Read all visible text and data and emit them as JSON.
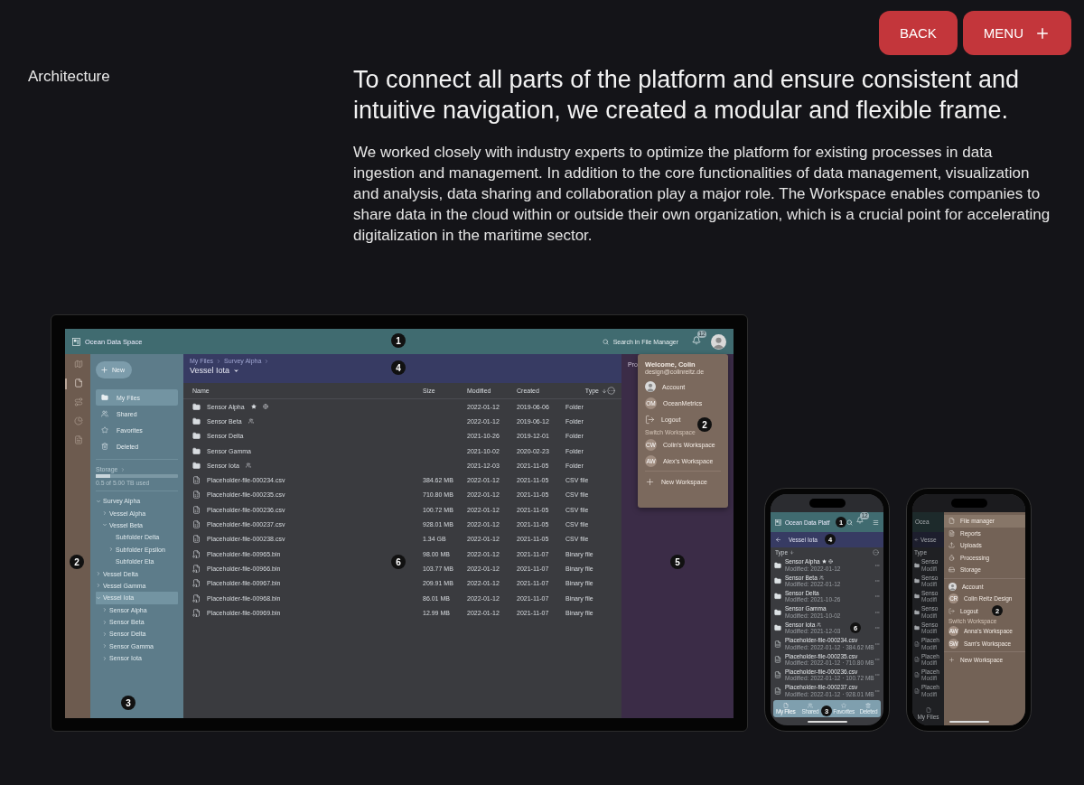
{
  "nav_buttons": [
    {
      "label": "BACK",
      "kind": "text"
    },
    {
      "label": "MENU",
      "kind": "plus"
    }
  ],
  "section_label": "Architecture",
  "heading": "To connect all parts of the platform and ensure consistent and intuitive navigation, we created a modular and flexible frame.",
  "body": "We worked closely with industry experts to optimize the platform for existing processes in data ingestion and management. In addition to the core functionalities of data management, visualization and analysis, data sharing and collaboration play a major role. The Workspace enables companies to share data in the cloud within or outside their own organization, which is a crucial point for accelerating digitalization in the maritime sector.",
  "desktop": {
    "app_title": "Ocean Data Space",
    "search_label": "Search in File Manager",
    "notification_count": "12",
    "rail": [
      {
        "kind": "map",
        "selected": false
      },
      {
        "kind": "file",
        "selected": true
      },
      {
        "kind": "route",
        "selected": false
      },
      {
        "kind": "chart",
        "selected": false
      },
      {
        "kind": "report",
        "selected": false
      }
    ],
    "new_button": "New",
    "nav_items": [
      {
        "label": "My Files",
        "kind": "folder",
        "selected": true
      },
      {
        "label": "Shared",
        "kind": "people",
        "selected": false
      },
      {
        "label": "Favorites",
        "kind": "star",
        "selected": false
      },
      {
        "label": "Deleted",
        "kind": "trash",
        "selected": false
      }
    ],
    "storage": {
      "label": "Storage",
      "level": 0.18,
      "caption": "0.5 of 5.00 TB used"
    },
    "tree": [
      {
        "label": "Survey Alpha",
        "expanded": true,
        "selected": false,
        "children": [
          {
            "label": "Vessel Alpha",
            "expanded": false,
            "selected": false
          },
          {
            "label": "Vessel Beta",
            "expanded": true,
            "selected": false,
            "children": [
              {
                "label": "Subfolder Delta",
                "selected": false
              },
              {
                "label": "Subfolder Epsilon",
                "expanded": false,
                "selected": false
              },
              {
                "label": "Subfolder Eta",
                "selected": false
              }
            ]
          }
        ]
      },
      {
        "label": "Vessel Delta",
        "expanded": false,
        "selected": false
      },
      {
        "label": "Vessel Gamma",
        "expanded": false,
        "selected": false
      },
      {
        "label": "Vessel Iota",
        "expanded": true,
        "selected": true,
        "children": [
          {
            "label": "Sensor Alpha",
            "expanded": false,
            "selected": false
          },
          {
            "label": "Sensor Beta",
            "expanded": false,
            "selected": false
          },
          {
            "label": "Sensor Delta",
            "expanded": false,
            "selected": false
          },
          {
            "label": "Sensor Gamma",
            "expanded": false,
            "selected": false
          },
          {
            "label": "Sensor Iota",
            "expanded": false,
            "selected": false
          }
        ]
      }
    ],
    "breadcrumb": [
      "My Files",
      "Survey Alpha"
    ],
    "folder_title": "Vessel Iota",
    "columns": [
      {
        "label": "Name",
        "sorted": false
      },
      {
        "label": "Size",
        "sorted": false
      },
      {
        "label": "Modified",
        "sorted": false
      },
      {
        "label": "Created",
        "sorted": false
      },
      {
        "label": "Type",
        "sorted": true
      }
    ],
    "rows": [
      {
        "kind": "folder",
        "name": "Sensor Alpha",
        "modified": "2022-01-12",
        "created": "2019-06-06",
        "type": "Folder",
        "starred": true,
        "public": true,
        "shared": false
      },
      {
        "kind": "folder",
        "name": "Sensor Beta",
        "modified": "2022-01-12",
        "created": "2019-06-12",
        "type": "Folder",
        "starred": false,
        "public": false,
        "shared": true
      },
      {
        "kind": "folder",
        "name": "Sensor Delta",
        "modified": "2021-10-26",
        "created": "2019-12-01",
        "type": "Folder",
        "starred": false,
        "public": false,
        "shared": false
      },
      {
        "kind": "folder",
        "name": "Sensor Gamma",
        "modified": "2021-10-02",
        "created": "2020-02-23",
        "type": "Folder",
        "starred": false,
        "public": false,
        "shared": false
      },
      {
        "kind": "folder",
        "name": "Sensor Iota",
        "modified": "2021-12-03",
        "created": "2021-11-05",
        "type": "Folder",
        "starred": false,
        "public": false,
        "shared": true
      },
      {
        "kind": "csv",
        "name": "Placeholder-file-000234.csv",
        "size": "384.62 MB",
        "modified": "2022-01-12",
        "created": "2021-11-05",
        "type": "CSV file",
        "starred": false,
        "public": false,
        "shared": false
      },
      {
        "kind": "csv",
        "name": "Placeholder-file-000235.csv",
        "size": "710.80 MB",
        "modified": "2022-01-12",
        "created": "2021-11-05",
        "type": "CSV file",
        "starred": false,
        "public": false,
        "shared": false
      },
      {
        "kind": "csv",
        "name": "Placeholder-file-000236.csv",
        "size": "100.72 MB",
        "modified": "2022-01-12",
        "created": "2021-11-05",
        "type": "CSV file",
        "starred": false,
        "public": false,
        "shared": false
      },
      {
        "kind": "csv",
        "name": "Placeholder-file-000237.csv",
        "size": "928.01 MB",
        "modified": "2022-01-12",
        "created": "2021-11-05",
        "type": "CSV file",
        "starred": false,
        "public": false,
        "shared": false
      },
      {
        "kind": "csv",
        "name": "Placeholder-file-000238.csv",
        "size": "1.34 GB",
        "modified": "2022-01-12",
        "created": "2021-11-05",
        "type": "CSV file",
        "starred": false,
        "public": false,
        "shared": false
      },
      {
        "kind": "bin",
        "name": "Placeholder-file-00965.bin",
        "size": "98.00 MB",
        "modified": "2022-01-12",
        "created": "2021-11-07",
        "type": "Binary file",
        "starred": false,
        "public": false,
        "shared": false
      },
      {
        "kind": "bin",
        "name": "Placeholder-file-00966.bin",
        "size": "103.77 MB",
        "modified": "2022-01-12",
        "created": "2021-11-07",
        "type": "Binary file",
        "starred": false,
        "public": false,
        "shared": false
      },
      {
        "kind": "bin",
        "name": "Placeholder-file-00967.bin",
        "size": "209.91 MB",
        "modified": "2022-01-12",
        "created": "2021-11-07",
        "type": "Binary file",
        "starred": false,
        "public": false,
        "shared": false
      },
      {
        "kind": "bin",
        "name": "Placeholder-file-00968.bin",
        "size": "86.01 MB",
        "modified": "2022-01-12",
        "created": "2021-11-07",
        "type": "Binary file",
        "starred": false,
        "public": false,
        "shared": false
      },
      {
        "kind": "bin",
        "name": "Placeholder-file-00969.bin",
        "size": "12.99 MB",
        "modified": "2022-01-12",
        "created": "2021-11-07",
        "type": "Binary file",
        "starred": false,
        "public": false,
        "shared": false
      }
    ],
    "side_tab": "Pro",
    "user_menu": {
      "greeting": "Welcome, Colin",
      "email": "design@colinreitz.de",
      "items": [
        {
          "kind": "avatar",
          "label": "Account"
        },
        {
          "kind": "initials",
          "initials": "OM",
          "label": "OceanMetrics"
        },
        {
          "kind": "logout",
          "label": "Logout"
        }
      ],
      "section": "Switch Workspace",
      "workspaces": [
        {
          "initials": "CW",
          "label": "Colin's Workspace"
        },
        {
          "initials": "AW",
          "label": "Alex's Workspace"
        }
      ],
      "new_workspace": "New Workspace"
    },
    "markers": [
      "1",
      "4",
      "2",
      "3",
      "6",
      "5",
      "2"
    ]
  },
  "phone_list": {
    "app_title": "Ocean Data Platf",
    "notification_count": "12",
    "folder_title": "Vessel Iota",
    "sort_label": "Type",
    "rows": [
      {
        "kind": "folder",
        "name": "Sensor Alpha",
        "meta": "Modified: 2022-01-12",
        "starred": true,
        "public": true,
        "shared": false
      },
      {
        "kind": "folder",
        "name": "Sensor Beta",
        "meta": "Modified: 2022-01-12",
        "starred": false,
        "public": false,
        "shared": true
      },
      {
        "kind": "folder",
        "name": "Sensor Delta",
        "meta": "Modified: 2021-10-26",
        "starred": false,
        "public": false,
        "shared": false
      },
      {
        "kind": "folder",
        "name": "Sensor Gamma",
        "meta": "Modified: 2021-10-02",
        "starred": false,
        "public": false,
        "shared": false
      },
      {
        "kind": "folder",
        "name": "Sensor Iota",
        "meta": "Modified: 2021-12-03",
        "starred": false,
        "public": false,
        "shared": true
      },
      {
        "kind": "csv",
        "name": "Placeholder-file-000234.csv",
        "meta": "Modified: 2022-01-12 · 384.62 MB",
        "starred": false,
        "public": false,
        "shared": false
      },
      {
        "kind": "csv",
        "name": "Placeholder-file-000235.csv",
        "meta": "Modified: 2022-01-12 · 710.80 MB",
        "starred": false,
        "public": false,
        "shared": false
      },
      {
        "kind": "csv",
        "name": "Placeholder-file-000236.csv",
        "meta": "Modified: 2022-01-12 · 100.72 MB",
        "starred": false,
        "public": false,
        "shared": false
      },
      {
        "kind": "csv",
        "name": "Placeholder-file-000237.csv",
        "meta": "Modified: 2022-01-12 · 928.01 MB",
        "starred": false,
        "public": false,
        "shared": false
      }
    ],
    "tabs": [
      {
        "label": "My Files",
        "kind": "file",
        "selected": true
      },
      {
        "label": "Shared",
        "kind": "people",
        "selected": false
      },
      {
        "label": "Favorites",
        "kind": "star",
        "selected": false
      },
      {
        "label": "Deleted",
        "kind": "trash",
        "selected": false
      }
    ],
    "markers": [
      "1",
      "4",
      "6",
      "3"
    ]
  },
  "phone_menu": {
    "behind": {
      "app_title": "Ocea",
      "folder_title": "Vesse",
      "sort_label": "Type",
      "rows": [
        {
          "kind": "folder",
          "name": "Senso",
          "meta": "Modifi"
        },
        {
          "kind": "folder",
          "name": "Senso",
          "meta": "Modifi"
        },
        {
          "kind": "folder",
          "name": "Senso",
          "meta": "Modifi"
        },
        {
          "kind": "folder",
          "name": "Senso",
          "meta": "Modifi"
        },
        {
          "kind": "folder",
          "name": "Senso",
          "meta": "Modifi"
        },
        {
          "kind": "csv",
          "name": "Placeh",
          "meta": "Modifi"
        },
        {
          "kind": "csv",
          "name": "Placeh",
          "meta": "Modifi"
        },
        {
          "kind": "csv",
          "name": "Placeh",
          "meta": "Modifi"
        },
        {
          "kind": "csv",
          "name": "Placeh",
          "meta": "Modifi"
        }
      ],
      "tab": "My Files"
    },
    "items": [
      {
        "kind": "file",
        "label": "File manager",
        "selected": true
      },
      {
        "kind": "report",
        "label": "Reports",
        "selected": false
      },
      {
        "kind": "upload",
        "label": "Uploads",
        "selected": false
      },
      {
        "kind": "processing",
        "label": "Processing",
        "selected": false
      },
      {
        "kind": "storage",
        "label": "Storage",
        "selected": false
      }
    ],
    "account": [
      {
        "kind": "avatar",
        "label": "Account"
      },
      {
        "kind": "initials",
        "initials": "CR",
        "label": "Colin Reitz Design"
      },
      {
        "kind": "logout",
        "label": "Logout"
      }
    ],
    "section": "Switch Workspace",
    "workspaces": [
      {
        "initials": "AW",
        "label": "Anna's Workspace"
      },
      {
        "initials": "SW",
        "label": "Sam's Workspace"
      }
    ],
    "new_workspace": "New Workspace",
    "markers": [
      "2"
    ]
  }
}
